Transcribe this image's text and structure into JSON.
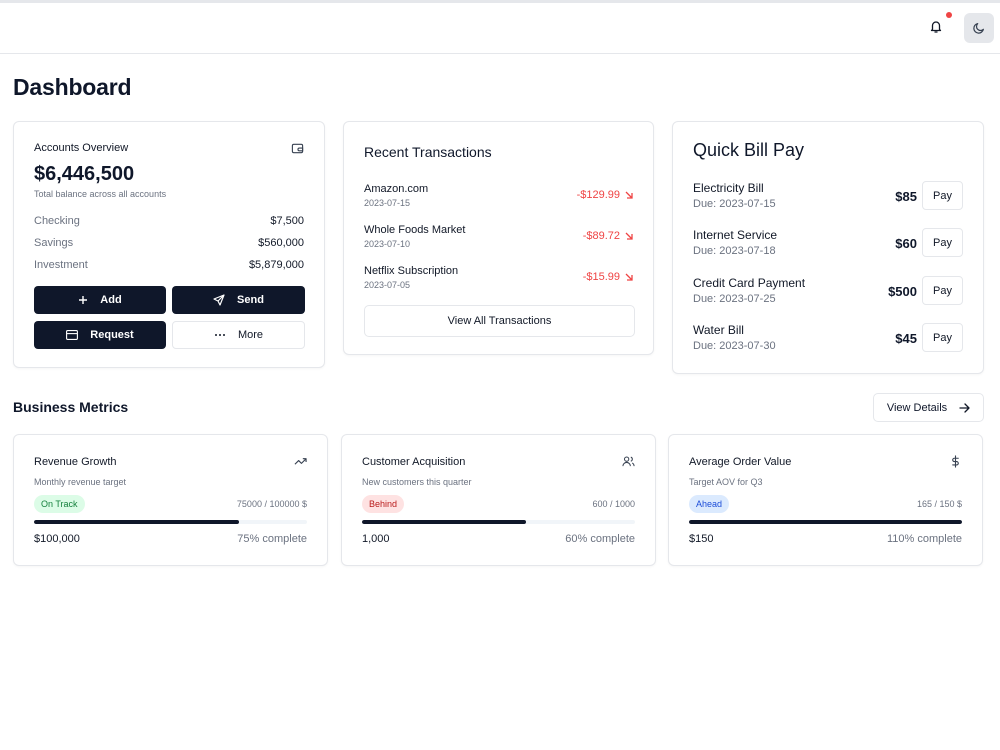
{
  "header": {
    "bell_icon": "bell-icon",
    "theme_icon": "moon-icon"
  },
  "page": {
    "title": "Dashboard"
  },
  "accounts": {
    "title": "Accounts Overview",
    "icon": "wallet-icon",
    "total": "$6,446,500",
    "total_caption": "Total balance across all accounts",
    "rows": [
      {
        "label": "Checking",
        "value": "$7,500"
      },
      {
        "label": "Savings",
        "value": "$560,000"
      },
      {
        "label": "Investment",
        "value": "$5,879,000"
      }
    ],
    "buttons": {
      "add": "Add",
      "send": "Send",
      "request": "Request",
      "more": "More"
    }
  },
  "transactions": {
    "title": "Recent Transactions",
    "items": [
      {
        "name": "Amazon.com",
        "date": "2023-07-15",
        "amount": "-$129.99"
      },
      {
        "name": "Whole Foods Market",
        "date": "2023-07-10",
        "amount": "-$89.72"
      },
      {
        "name": "Netflix Subscription",
        "date": "2023-07-05",
        "amount": "-$15.99"
      }
    ],
    "view_all": "View All Transactions"
  },
  "bills": {
    "title": "Quick Bill Pay",
    "pay_label": "Pay",
    "items": [
      {
        "name": "Electricity Bill",
        "due": "Due: 2023-07-15",
        "amount": "$85"
      },
      {
        "name": "Internet Service",
        "due": "Due: 2023-07-18",
        "amount": "$60"
      },
      {
        "name": "Credit Card Payment",
        "due": "Due: 2023-07-25",
        "amount": "$500"
      },
      {
        "name": "Water Bill",
        "due": "Due: 2023-07-30",
        "amount": "$45"
      }
    ]
  },
  "metrics": {
    "title": "Business Metrics",
    "view_details": "View Details",
    "cards": [
      {
        "title": "Revenue Growth",
        "icon": "trending-up-icon",
        "subtitle": "Monthly revenue target",
        "badge": "On Track",
        "badge_bg": "#dcfce7",
        "badge_color": "#15803d",
        "ratio": "75000 / 100000 $",
        "progress": 0.75,
        "value": "$100,000",
        "percent_text": "75% complete"
      },
      {
        "title": "Customer Acquisition",
        "icon": "users-icon",
        "subtitle": "New customers this quarter",
        "badge": "Behind",
        "badge_bg": "#fee2e2",
        "badge_color": "#b91c1c",
        "ratio": "600 / 1000",
        "progress": 0.6,
        "value": "1,000",
        "percent_text": "60% complete"
      },
      {
        "title": "Average Order Value",
        "icon": "dollar-icon",
        "subtitle": "Target AOV for Q3",
        "badge": "Ahead",
        "badge_bg": "#dbeafe",
        "badge_color": "#1d4ed8",
        "ratio": "165 / 150 $",
        "progress": 1.0,
        "value": "$150",
        "percent_text": "110% complete"
      }
    ]
  }
}
